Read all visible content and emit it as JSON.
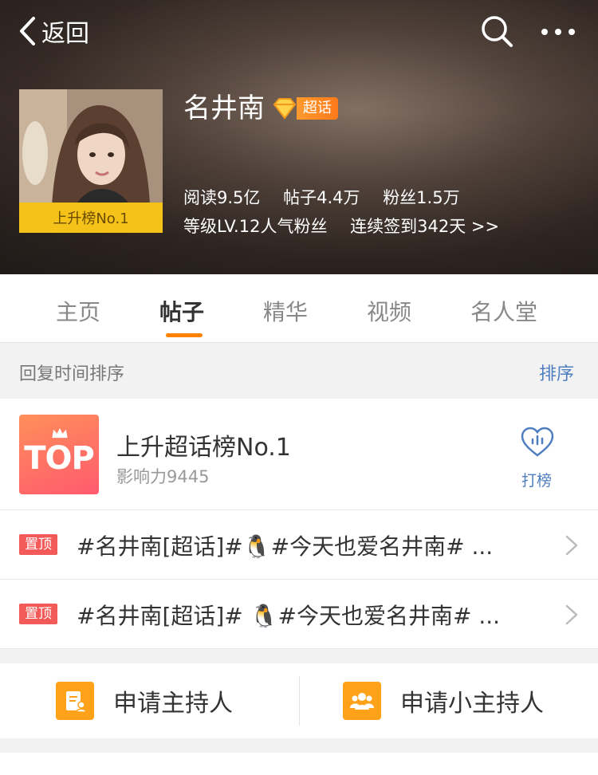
{
  "nav": {
    "back_label": "返回"
  },
  "profile": {
    "name": "名井南",
    "super_badge": "超话",
    "avatar_badge": "上升榜No.1",
    "stats": {
      "reads": "阅读9.5亿",
      "posts": "帖子4.4万",
      "fans": "粉丝1.5万"
    },
    "level": "等级LV.12人气粉丝",
    "checkin": "连续签到342天 >>"
  },
  "tabs": [
    {
      "label": "主页"
    },
    {
      "label": "帖子",
      "active": true
    },
    {
      "label": "精华"
    },
    {
      "label": "视频"
    },
    {
      "label": "名人堂"
    }
  ],
  "sortbar": {
    "label": "回复时间排序",
    "action": "排序"
  },
  "rank": {
    "logo_text": "TOP",
    "title": "上升超话榜No.1",
    "influence": "影响力9445",
    "action": "打榜"
  },
  "pinned": [
    {
      "tag": "置顶",
      "text": "#名井南[超话]#🐧#今天也爱名井南# ..."
    },
    {
      "tag": "置顶",
      "text": "#名井南[超话]# 🐧#今天也爱名井南# ..."
    }
  ],
  "apply": [
    {
      "label": "申请主持人",
      "icon": "host-icon"
    },
    {
      "label": "申请小主持人",
      "icon": "group-icon"
    }
  ],
  "colors": {
    "accent": "#ff8200",
    "link": "#4e7ec0",
    "pin_tag": "#f25a5a",
    "badge": "#f5c21a"
  }
}
